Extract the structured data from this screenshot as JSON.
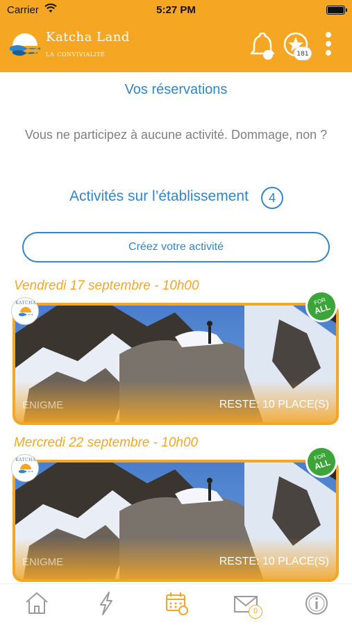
{
  "status_bar": {
    "carrier": "Carrier",
    "time": "5:27 PM"
  },
  "header": {
    "brand": "Katcha Land",
    "tagline": "la convivialité",
    "star_badge": "181"
  },
  "reservations": {
    "title": "Vos réservations",
    "empty_message": "Vous ne participez à aucune activité. Dommage, non ?"
  },
  "activities": {
    "title": "Activités sur l’établissement",
    "count": "4",
    "create_button": "Créez votre activité",
    "items": [
      {
        "date": "Vendredi 17 septembre - 10h00",
        "category": "ENIGME",
        "places": "RESTE: 10 PLACE(S)",
        "badge_top": "FOR",
        "badge_bottom": "ALL",
        "logo_text": "KATCHA"
      },
      {
        "date": "Mercredi 22 septembre - 10h00",
        "category": "ENIGME",
        "places": "RESTE: 10 PLACE(S)",
        "badge_top": "FOR",
        "badge_bottom": "ALL",
        "logo_text": "KATCHA"
      }
    ]
  },
  "tabbar": {
    "items": [
      {
        "icon": "home-icon"
      },
      {
        "icon": "lightning-icon"
      },
      {
        "icon": "calendar-icon",
        "active": true
      },
      {
        "icon": "mail-icon",
        "badge": "0"
      },
      {
        "icon": "info-icon"
      }
    ]
  },
  "colors": {
    "accent": "#f5a623",
    "link": "#2f86c9",
    "muted": "#808080",
    "badge_green": "#3ca53a"
  }
}
